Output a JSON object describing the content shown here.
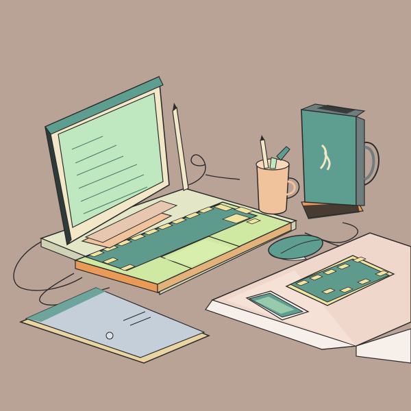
{
  "scene": {
    "description_free": true,
    "palette": {
      "background": "#b9a296",
      "outline": "#2b2b2b",
      "teal": "#5e9e90",
      "mint": "#bfe8c0",
      "cream": "#f2e7c7",
      "peach": "#f0c39d",
      "orange": "#e99a57",
      "lime": "#cfe8a2",
      "keys_teal": "#5f9b8c",
      "keys_yellow": "#f0e4a2",
      "mat_pink": "#f0d7cc",
      "mat_white": "#f7efe9"
    },
    "objects": {
      "monitor": "monitor-illustration",
      "keyboard": "keyboard-illustration",
      "tablet": "tablet-illustration",
      "mouse": "mouse-illustration",
      "mini_keyboard": "mini-keyboard-illustration",
      "phone": "phone-illustration",
      "pen_cup": "pen-cup-illustration",
      "mug": "mug-illustration",
      "cables": "cable-illustration"
    }
  }
}
